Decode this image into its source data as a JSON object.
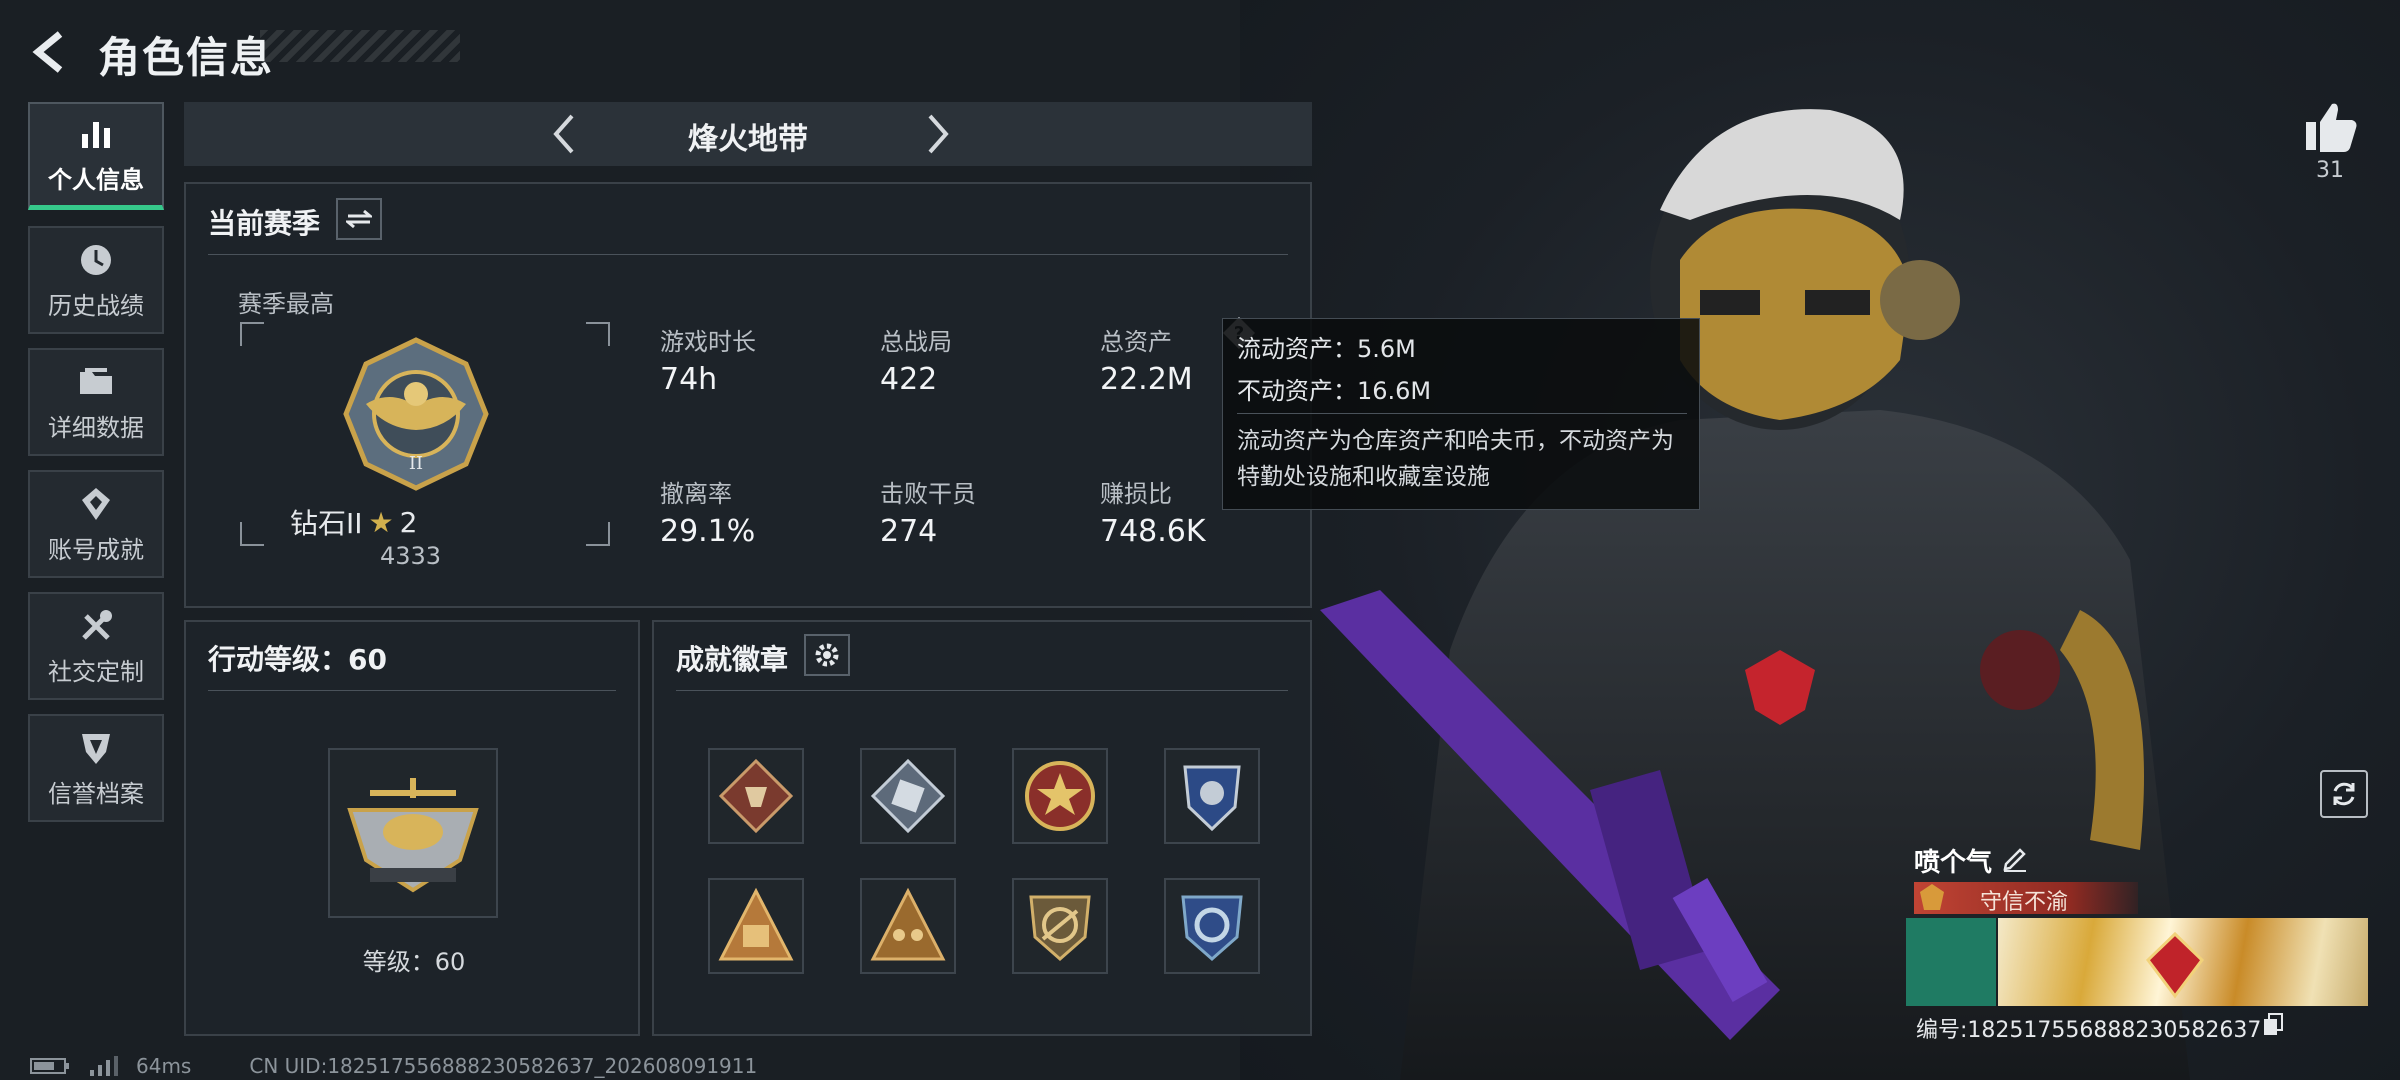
{
  "header": {
    "title": "角色信息"
  },
  "sidebar": {
    "items": [
      {
        "label": "个人信息",
        "icon": "bar-chart-icon",
        "active": true
      },
      {
        "label": "历史战绩",
        "icon": "history-icon"
      },
      {
        "label": "详细数据",
        "icon": "folder-icon"
      },
      {
        "label": "账号成就",
        "icon": "achievement-icon"
      },
      {
        "label": "社交定制",
        "icon": "tools-icon"
      },
      {
        "label": "信誉档案",
        "icon": "credit-icon"
      }
    ]
  },
  "mode_nav": {
    "title": "烽火地带"
  },
  "season": {
    "title": "当前赛季",
    "best_label": "赛季最高",
    "rank_name": "钻石II",
    "rank_stars": "2",
    "rank_score": "4333",
    "stats": [
      {
        "label": "游戏时长",
        "value": "74h"
      },
      {
        "label": "总战局",
        "value": "422"
      },
      {
        "label": "总资产",
        "value": "22.2M"
      },
      {
        "label": "撤离率",
        "value": "29.1%"
      },
      {
        "label": "击败干员",
        "value": "274"
      },
      {
        "label": "赚损比",
        "value": "748.6K"
      }
    ]
  },
  "tooltip": {
    "liquid": "流动资产：5.6M",
    "fixed": "不动资产：16.6M",
    "desc": "流动资产为仓库资产和哈夫币，不动资产为特勤处设施和收藏室设施"
  },
  "action_level": {
    "title": "行动等级：60",
    "level_text": "等级：60"
  },
  "badges": {
    "title": "成就徽章"
  },
  "profile": {
    "likes": "31",
    "nickname": "喷个气",
    "honor": "守信不渝",
    "card_id": "编号:1825175568882305826​37"
  },
  "status_bar": {
    "ping": "64ms",
    "uid": "CN UID:182517556888230582637_202608091911"
  },
  "colors": {
    "accent": "#36c98b",
    "gold": "#c9a24a"
  }
}
